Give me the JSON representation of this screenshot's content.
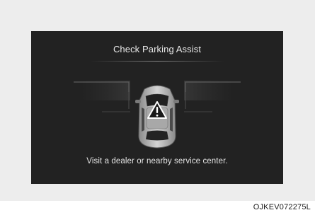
{
  "warning": {
    "title": "Check Parking Assist",
    "message": "Visit a dealer or nearby service center.",
    "icon": "warning-triangle-icon"
  },
  "figure_code": "OJKEV072275L",
  "colors": {
    "screen_background": "#222222",
    "frame_background": "#ededed",
    "text": "#e9e9e9"
  }
}
